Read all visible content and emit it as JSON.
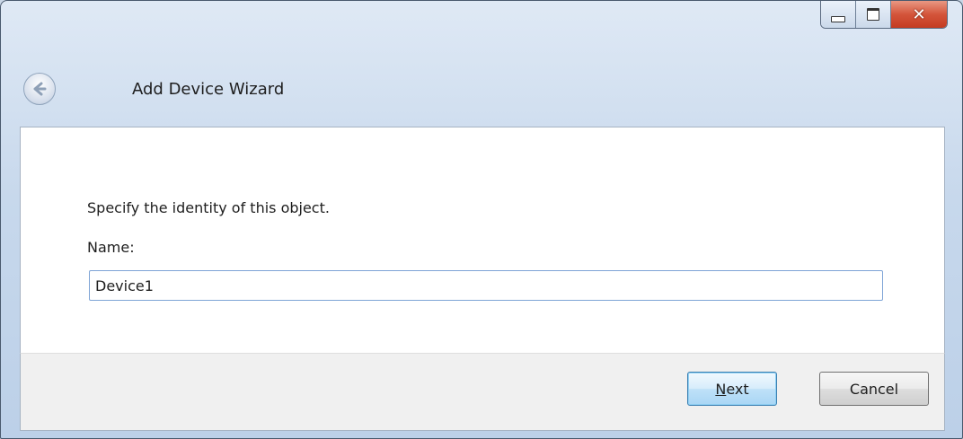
{
  "window": {
    "title": "Add Device Wizard",
    "controls": {
      "minimize": "minimize-icon",
      "maximize": "maximize-icon",
      "close": "close-icon"
    },
    "back_icon": "back-arrow-icon"
  },
  "content": {
    "prompt": "Specify the identity of this object.",
    "name_label": "Name:",
    "name_value": "Device1"
  },
  "footer": {
    "next_access_key": "N",
    "next_rest": "ext",
    "cancel_label": "Cancel"
  },
  "colors": {
    "titlebar": "#c7d8ec",
    "close_button": "#c43b21",
    "default_button": "#bfe1f8"
  }
}
